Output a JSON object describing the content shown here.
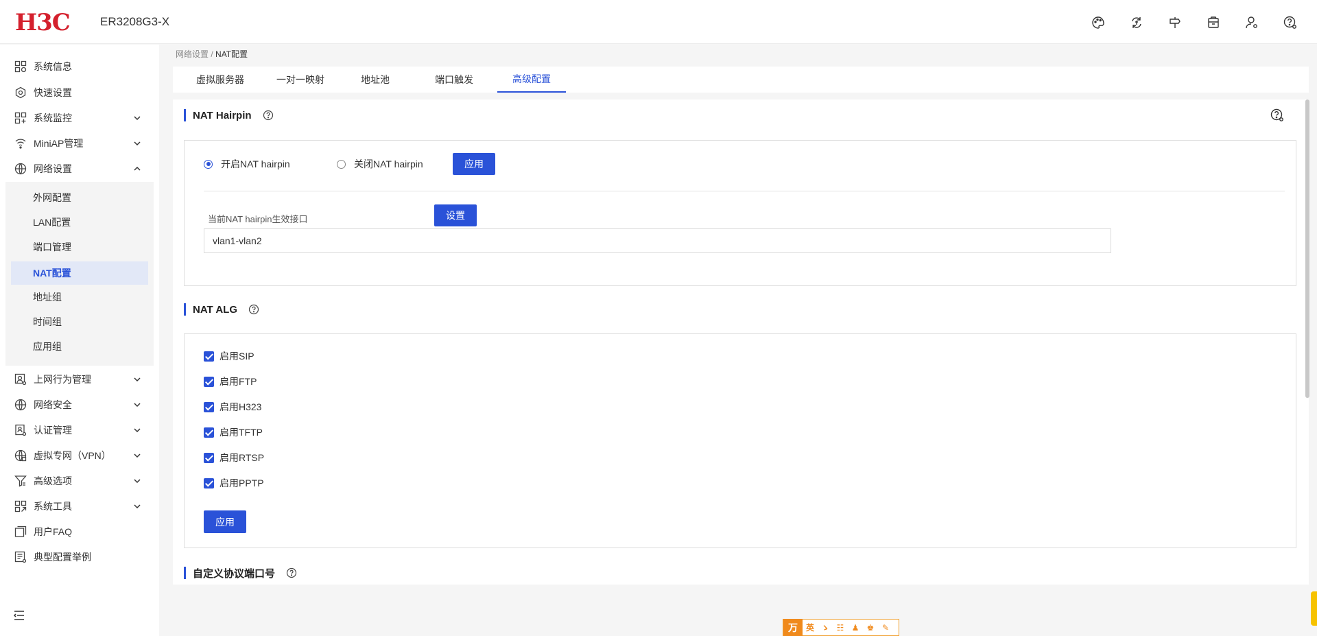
{
  "header": {
    "brand": "H3C",
    "model": "ER3208G3-X",
    "icons": [
      "palette-icon",
      "exchange-icon",
      "signpost-icon",
      "package-icon",
      "user-settings-icon",
      "help-settings-icon"
    ]
  },
  "sidebar": {
    "items": [
      {
        "label": "系统信息",
        "icon": "system-info-icon",
        "expandable": false
      },
      {
        "label": "快速设置",
        "icon": "quick-setup-icon",
        "expandable": false
      },
      {
        "label": "系统监控",
        "icon": "monitor-icon",
        "expandable": true
      },
      {
        "label": "MiniAP管理",
        "icon": "wifi-icon",
        "expandable": true
      },
      {
        "label": "网络设置",
        "icon": "globe-icon",
        "expandable": true,
        "expanded": true
      },
      {
        "label": "上网行为管理",
        "icon": "behavior-icon",
        "expandable": true
      },
      {
        "label": "网络安全",
        "icon": "security-icon",
        "expandable": true
      },
      {
        "label": "认证管理",
        "icon": "auth-icon",
        "expandable": true
      },
      {
        "label": "虚拟专网（VPN）",
        "icon": "vpn-icon",
        "expandable": true
      },
      {
        "label": "高级选项",
        "icon": "filter-icon",
        "expandable": true
      },
      {
        "label": "系统工具",
        "icon": "tools-icon",
        "expandable": true
      },
      {
        "label": "用户FAQ",
        "icon": "faq-icon",
        "expandable": false
      },
      {
        "label": "典型配置举例",
        "icon": "example-icon",
        "expandable": false
      }
    ],
    "subitems": [
      "外网配置",
      "LAN配置",
      "端口管理",
      "NAT配置",
      "地址组",
      "时间组",
      "应用组"
    ],
    "active_subitem": "NAT配置"
  },
  "breadcrumb": {
    "parent": "网络设置",
    "separator": " / ",
    "current": "NAT配置"
  },
  "tabs": [
    "虚拟服务器",
    "一对一映射",
    "地址池",
    "端口触发",
    "高级配置"
  ],
  "active_tab": "高级配置",
  "hairpin": {
    "title": "NAT Hairpin",
    "enable_label": "开启NAT hairpin",
    "disable_label": "关闭NAT hairpin",
    "selected": "enable",
    "apply_label": "应用",
    "interface_label": "当前NAT hairpin生效接口",
    "set_label": "设置",
    "interface_value": "vlan1-vlan2"
  },
  "alg": {
    "title": "NAT ALG",
    "options": [
      {
        "label": "启用SIP",
        "checked": true
      },
      {
        "label": "启用FTP",
        "checked": true
      },
      {
        "label": "启用H323",
        "checked": true
      },
      {
        "label": "启用TFTP",
        "checked": true
      },
      {
        "label": "启用RTSP",
        "checked": true
      },
      {
        "label": "启用PPTP",
        "checked": true
      }
    ],
    "apply_label": "应用"
  },
  "custom_port": {
    "title": "自定义协议端口号"
  },
  "float_toolbar": {
    "logo": "万",
    "items": [
      "英",
      "ゝ",
      "☷",
      "♟",
      "♚",
      "✎"
    ]
  }
}
